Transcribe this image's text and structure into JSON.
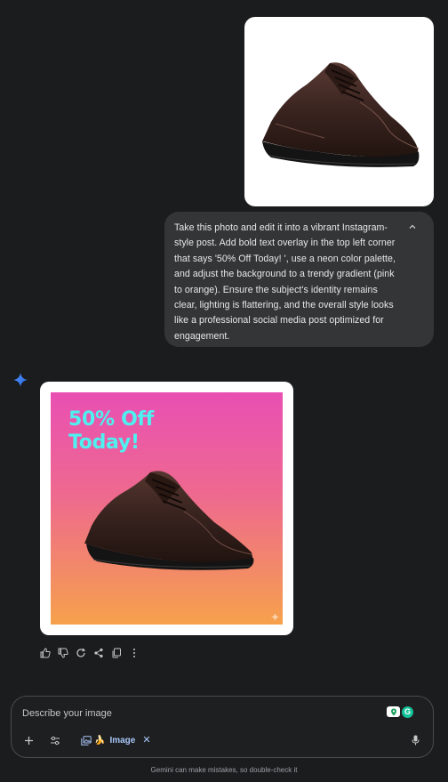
{
  "user_message": {
    "image_alt": "Brown leather lace-up shoe",
    "text": "Take this photo and edit it into a vibrant Instagram-style post. Add bold text overlay in the top left corner that says '50% Off Today! ', use a neon color palette, and adjust the background to a trendy gradient (pink to orange). Ensure the subject's identity remains clear, lighting is flattering, and the overall style looks like a professional social media post optimized for engagement."
  },
  "response": {
    "overlay_line1": "50% Off",
    "overlay_line2": "Today!",
    "icons": [
      "thumbs-up-icon",
      "thumbs-down-icon",
      "regenerate-icon",
      "share-icon",
      "copy-icon",
      "more-icon"
    ]
  },
  "composer": {
    "placeholder": "Describe your image",
    "tool_chip_emoji": "🍌",
    "tool_chip_label": "Image",
    "tool_chip_close": "✕",
    "grammarly_letter": "G"
  },
  "footer": {
    "disclaimer": "Gemini can make mistakes, so double-check it"
  },
  "colors": {
    "background": "#1b1c1d",
    "bubble": "#333537",
    "accent": "#a8c7fa",
    "gradient_top": "#e94fb3",
    "gradient_bottom": "#f6a14c",
    "overlay_text": "#4ff0f0"
  }
}
